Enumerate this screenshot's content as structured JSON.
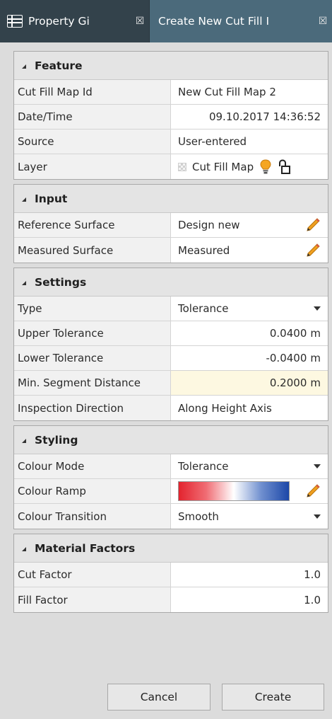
{
  "tabs": [
    {
      "label": "Property Gi",
      "close": "☒"
    },
    {
      "label": "Create New Cut Fill I",
      "close": "☒"
    }
  ],
  "sections": {
    "feature": {
      "title": "Feature",
      "rows": {
        "id": {
          "label": "Cut Fill Map Id",
          "value": "New Cut Fill Map 2"
        },
        "datetime": {
          "label": "Date/Time",
          "value": "09.10.2017 14:36:52"
        },
        "source": {
          "label": "Source",
          "value": "User-entered"
        },
        "layer": {
          "label": "Layer",
          "value": "Cut Fill Map"
        }
      }
    },
    "input": {
      "title": "Input",
      "rows": {
        "reference": {
          "label": "Reference Surface",
          "value": "Design new"
        },
        "measured": {
          "label": "Measured Surface",
          "value": "Measured"
        }
      }
    },
    "settings": {
      "title": "Settings",
      "rows": {
        "type": {
          "label": "Type",
          "value": "Tolerance"
        },
        "upper": {
          "label": "Upper Tolerance",
          "value": "0.0400",
          "unit": "m"
        },
        "lower": {
          "label": "Lower Tolerance",
          "value": "-0.0400",
          "unit": "m"
        },
        "minseg": {
          "label": "Min. Segment Distance",
          "value": "0.2000",
          "unit": "m"
        },
        "direction": {
          "label": "Inspection Direction",
          "value": "Along Height Axis"
        }
      }
    },
    "styling": {
      "title": "Styling",
      "rows": {
        "mode": {
          "label": "Colour Mode",
          "value": "Tolerance"
        },
        "ramp": {
          "label": "Colour Ramp"
        },
        "transition": {
          "label": "Colour Transition",
          "value": "Smooth"
        }
      }
    },
    "material": {
      "title": "Material Factors",
      "rows": {
        "cut": {
          "label": "Cut Factor",
          "value": "1.0"
        },
        "fill": {
          "label": "Fill Factor",
          "value": "1.0"
        }
      }
    }
  },
  "buttons": {
    "cancel": "Cancel",
    "create": "Create"
  },
  "icons": {
    "grid": "grid-icon",
    "pencil": "pencil-icon",
    "bulb": "lightbulb-icon",
    "lock": "unlock-icon",
    "dropdown": "chevron-down-icon"
  },
  "colors": {
    "tab_active": "#4b6a7b",
    "tab_inactive": "#33424b",
    "ramp": [
      "#e3232e",
      "#ffffff",
      "#1c47a8"
    ],
    "highlight": "#fdf8e1"
  }
}
